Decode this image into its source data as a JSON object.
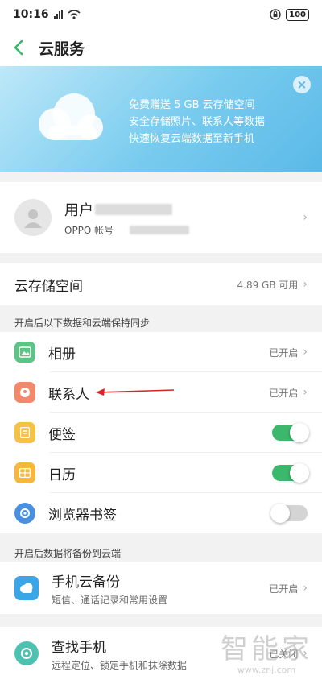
{
  "status_bar": {
    "time": "10:16",
    "battery": "100"
  },
  "header": {
    "title": "云服务"
  },
  "banner": {
    "lines": [
      "免费赠送 5 GB 云存储空间",
      "安全存储照片、联系人等数据",
      "快速恢复云端数据至新手机"
    ],
    "close": "×"
  },
  "account": {
    "name": "用户",
    "sublabel": "OPPO 帐号"
  },
  "storage": {
    "label": "云存储空间",
    "value": "4.89 GB 可用"
  },
  "sync_section": {
    "header": "开启后以下数据和云端保持同步",
    "items": [
      {
        "label": "相册",
        "status": "已开启"
      },
      {
        "label": "联系人",
        "status": "已开启"
      },
      {
        "label": "便签",
        "toggle": true
      },
      {
        "label": "日历",
        "toggle": true
      },
      {
        "label": "浏览器书签",
        "toggle": false
      }
    ]
  },
  "backup_section": {
    "header": "开启后数据将备份到云端",
    "item": {
      "label": "手机云备份",
      "sublabel": "短信、通话记录和常用设置",
      "status": "已开启"
    }
  },
  "find_phone": {
    "label": "查找手机",
    "sublabel": "远程定位、锁定手机和抹除数据",
    "status": "已关闭"
  },
  "watermark": {
    "big": "智能家",
    "small": "www.znj.com"
  },
  "colors": {
    "accent_green": "#3bb86b",
    "banner_blue": "#78cbee",
    "arrow_red": "#d9252a"
  }
}
